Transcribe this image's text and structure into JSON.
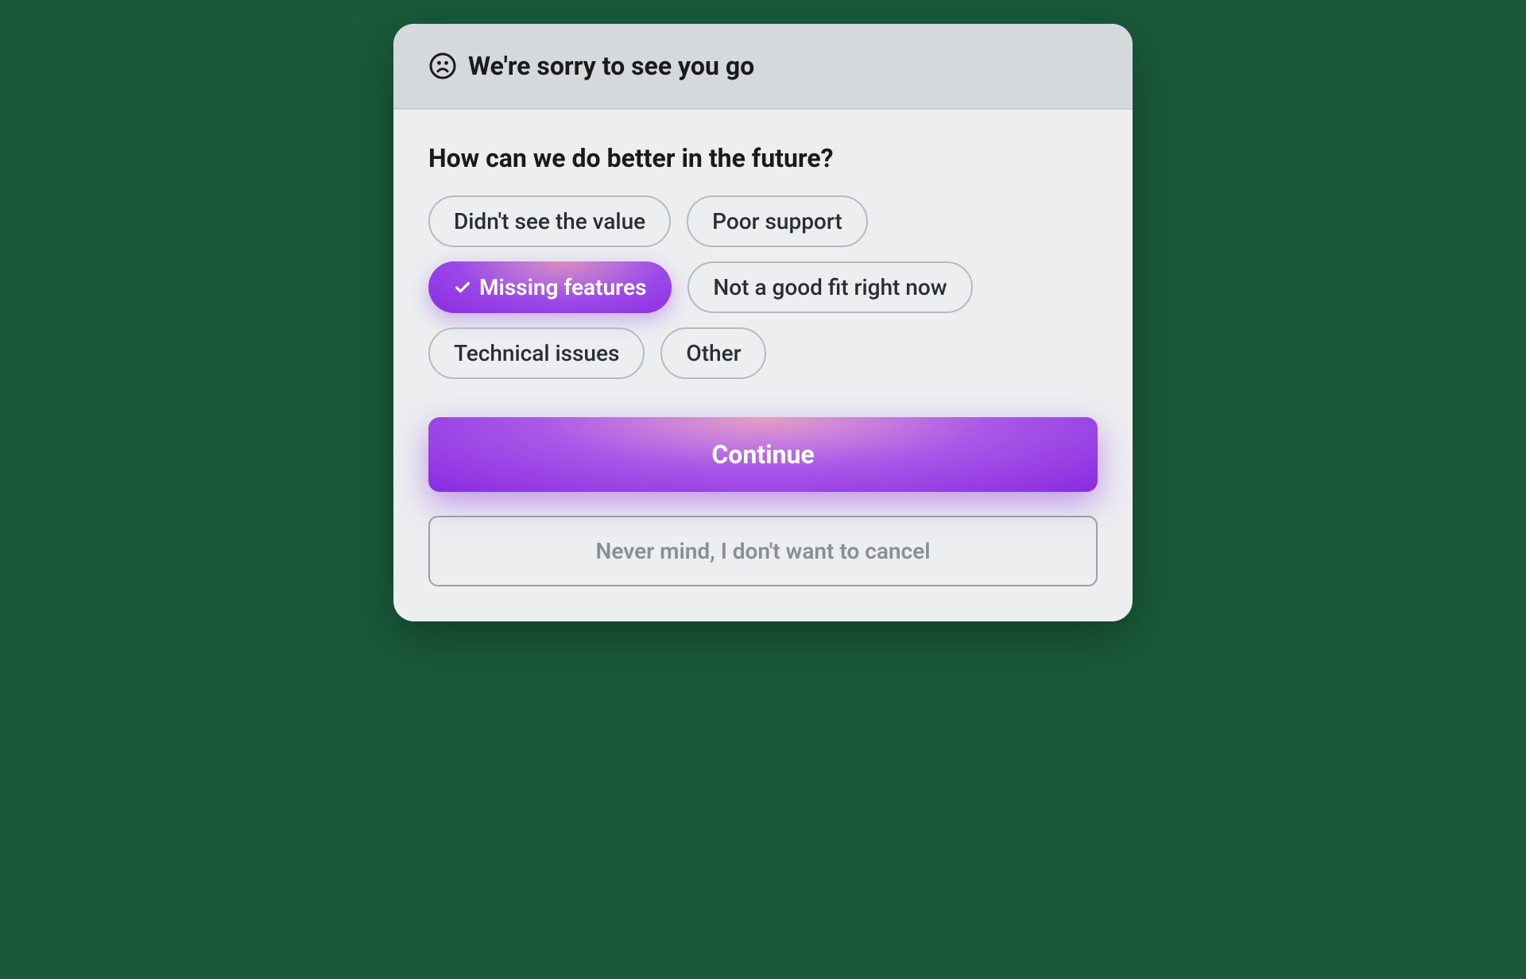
{
  "dialog": {
    "title": "We're sorry to see you go",
    "question": "How can we do better in the future?",
    "reasons": [
      {
        "label": "Didn't see the value",
        "selected": false
      },
      {
        "label": "Poor support",
        "selected": false
      },
      {
        "label": "Missing features",
        "selected": true
      },
      {
        "label": "Not a good fit right now",
        "selected": false
      },
      {
        "label": "Technical issues",
        "selected": false
      },
      {
        "label": "Other",
        "selected": false
      }
    ],
    "primary_button": "Continue",
    "secondary_button": "Never mind, I don't want to cancel"
  },
  "colors": {
    "background_page": "#1a5a3a",
    "dialog_bg": "#eceef0",
    "header_bg": "#d6d9dc",
    "accent_gradient_start": "#d98fbf",
    "accent_gradient_end": "#8a2be2",
    "chip_border": "#b6bbc0",
    "text_primary": "#1a1a1a",
    "text_muted": "#8a8f96"
  }
}
